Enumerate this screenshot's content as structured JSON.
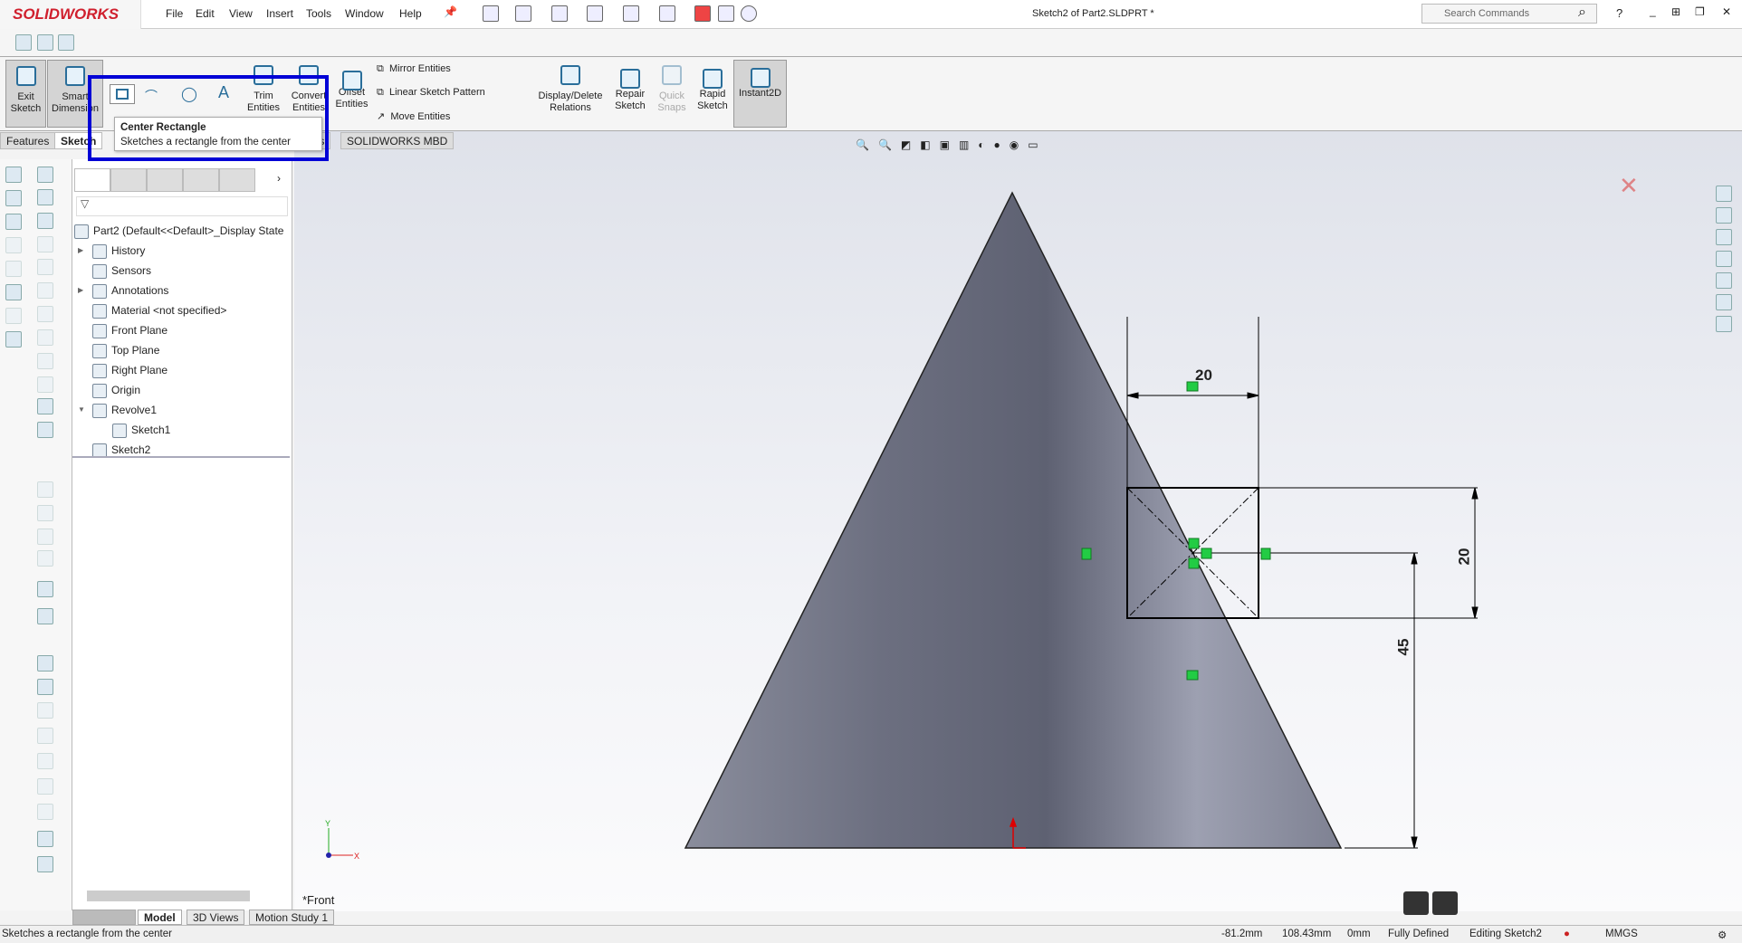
{
  "app": {
    "brand": "SOLIDWORKS",
    "title": "Sketch2 of Part2.SLDPRT *"
  },
  "menu": [
    "File",
    "Edit",
    "View",
    "Insert",
    "Tools",
    "Window",
    "Help"
  ],
  "search": {
    "placeholder": "Search Commands"
  },
  "commands": {
    "exit_sketch": "Exit Sketch",
    "smart_dimension": "Smart Dimension",
    "trim": "Trim Entities",
    "convert": "Convert Entities",
    "offset": "Offset Entities",
    "mirror": "Mirror Entities",
    "linear_pattern": "Linear Sketch Pattern",
    "move": "Move Entities",
    "relations": "Display/Delete Relations",
    "repair": "Repair Sketch",
    "quick_snaps": "Quick Snaps",
    "rapid": "Rapid Sketch",
    "instant2d": "Instant2D"
  },
  "tabs": [
    "Features",
    "Sketch",
    "Add-Ins",
    "SOLIDWORKS MBD"
  ],
  "tooltip": {
    "title": "Center Rectangle",
    "body": "Sketches a rectangle from the center"
  },
  "tree": {
    "root": "Part2  (Default<<Default>_Display State",
    "items": [
      {
        "label": "History",
        "icon": "history-folder-icon",
        "expand": true,
        "indent": 0
      },
      {
        "label": "Sensors",
        "icon": "sensors-folder-icon",
        "expand": false,
        "indent": 0
      },
      {
        "label": "Annotations",
        "icon": "annotations-folder-icon",
        "expand": true,
        "indent": 0
      },
      {
        "label": "Material <not specified>",
        "icon": "material-icon",
        "expand": false,
        "indent": 0
      },
      {
        "label": "Front Plane",
        "icon": "plane-icon",
        "expand": false,
        "indent": 0
      },
      {
        "label": "Top Plane",
        "icon": "plane-icon",
        "expand": false,
        "indent": 0
      },
      {
        "label": "Right Plane",
        "icon": "plane-icon",
        "expand": false,
        "indent": 0
      },
      {
        "label": "Origin",
        "icon": "origin-icon",
        "expand": false,
        "indent": 0
      },
      {
        "label": "Revolve1",
        "icon": "revolve-icon",
        "expand": "open",
        "indent": 0
      },
      {
        "label": "Sketch1",
        "icon": "sketch-icon",
        "expand": false,
        "indent": 1
      },
      {
        "label": "Sketch2",
        "icon": "sketch-icon",
        "expand": false,
        "indent": 0
      }
    ]
  },
  "viewport": {
    "view_name": "*Front",
    "dims": {
      "width": "20",
      "height": "20",
      "offset": "45"
    },
    "sketch_color": "#000000",
    "relation_color": "#22cc44"
  },
  "bottom_tabs": [
    "Model",
    "3D Views",
    "Motion Study 1"
  ],
  "status": {
    "message": "Sketches a rectangle from the center",
    "x": "-81.2mm",
    "y": "108.43mm",
    "z": "0mm",
    "state": "Fully Defined",
    "mode": "Editing Sketch2",
    "units": "MMGS"
  }
}
